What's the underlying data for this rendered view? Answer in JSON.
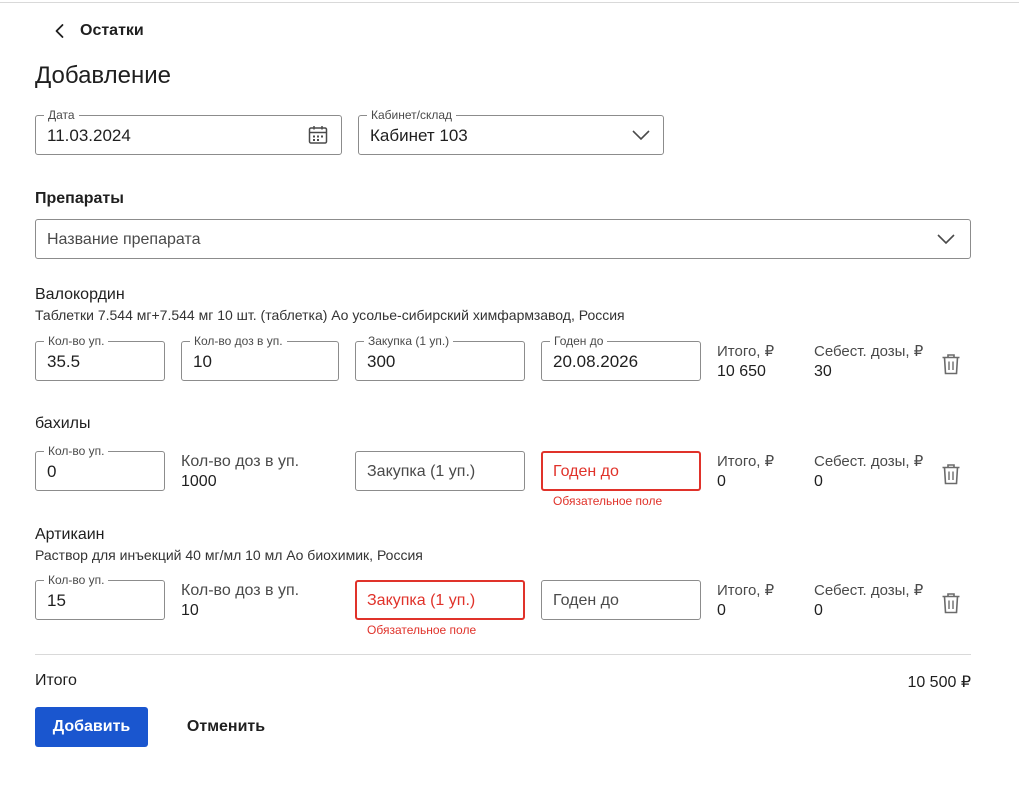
{
  "header": {
    "back_label": "Остатки",
    "title": "Добавление"
  },
  "form": {
    "date_label": "Дата",
    "date_value": "11.03.2024",
    "cabinet_label": "Кабинет/склад",
    "cabinet_value": "Кабинет 103"
  },
  "drugs_section": {
    "title": "Препараты",
    "select_placeholder": "Название препарата"
  },
  "items": [
    {
      "name": "Валокордин",
      "description": "Таблетки 7.544 мг+7.544 мг 10 шт. (таблетка) Ао усолье-сибирский химфармзавод, Россия",
      "qty_label": "Кол-во уп.",
      "qty_value": "35.5",
      "doses_label": "Кол-во доз в уп.",
      "doses_value": "10",
      "price_label": "Закупка (1 уп.)",
      "price_value": "300",
      "expiry_label": "Годен до",
      "expiry_value": "20.08.2026",
      "total_label": "Итого, ₽",
      "total_value": "10 650",
      "cost_label": "Себест. дозы, ₽",
      "cost_value": "30"
    },
    {
      "name": "бахилы",
      "qty_label": "Кол-во уп.",
      "qty_value": "0",
      "doses_label": "Кол-во доз в уп.",
      "doses_value": "1000",
      "price_placeholder": "Закупка (1 уп.)",
      "expiry_placeholder": "Годен до",
      "expiry_error": "Обязательное поле",
      "total_label": "Итого, ₽",
      "total_value": "0",
      "cost_label": "Себест. дозы, ₽",
      "cost_value": "0"
    },
    {
      "name": "Артикаин",
      "description": "Раствор для инъекций 40 мг/мл 10 мл Ао биохимик, Россия",
      "qty_label": "Кол-во уп.",
      "qty_value": "15",
      "doses_label": "Кол-во доз в уп.",
      "doses_value": "10",
      "price_placeholder": "Закупка (1 уп.)",
      "price_error": "Обязательное поле",
      "expiry_placeholder": "Годен до",
      "total_label": "Итого, ₽",
      "total_value": "0",
      "cost_label": "Себест. дозы, ₽",
      "cost_value": "0"
    }
  ],
  "summary": {
    "label": "Итого",
    "value": "10 500 ₽"
  },
  "actions": {
    "submit_label": "Добавить",
    "cancel_label": "Отменить"
  },
  "colors": {
    "primary": "#1a56cf",
    "error": "#e0322a",
    "border": "#8c8c8c"
  },
  "icons": {
    "back": "chevron-left-icon",
    "date": "calendar-icon",
    "select": "chevron-down-icon",
    "delete": "trash-icon"
  }
}
